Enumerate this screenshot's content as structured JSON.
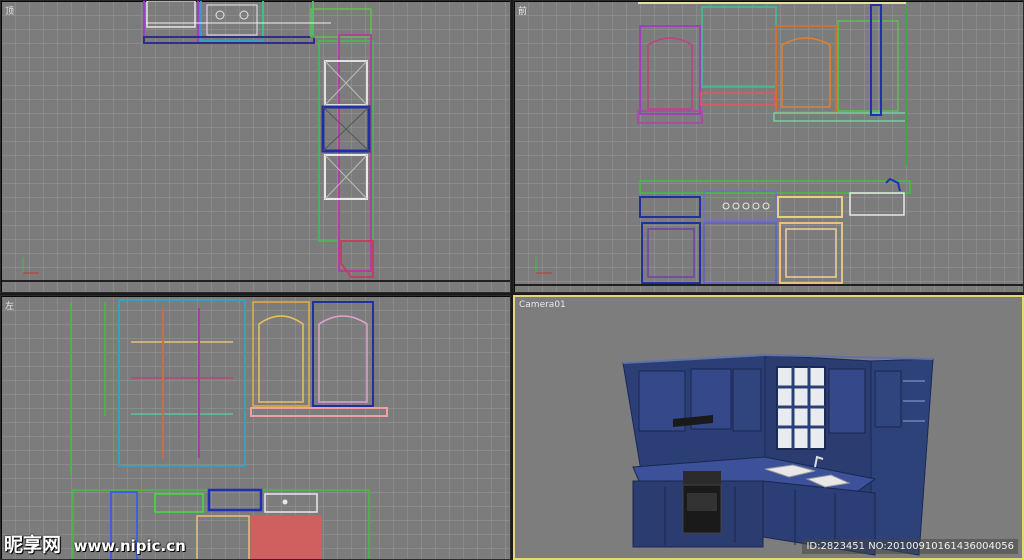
{
  "viewports": {
    "top": {
      "label": "顶",
      "accent": "#2a2a2a"
    },
    "front": {
      "label": "前",
      "accent": "#2a2a2a"
    },
    "left": {
      "label": "左",
      "accent": "#2a2a2a"
    },
    "camera": {
      "label": "Camera01",
      "accent": "#e7d777"
    }
  },
  "watermark": {
    "brand": "昵享网",
    "url": "www.nipic.cn"
  },
  "image_id_stamp": "ID:2823451 NO:20100910161436004056",
  "colors": {
    "grid_bg": "#7c7c7c",
    "active_border": "#e7d777",
    "model_blue": "#2b3f76"
  },
  "icons": [
    "axis-tripod-icon"
  ]
}
